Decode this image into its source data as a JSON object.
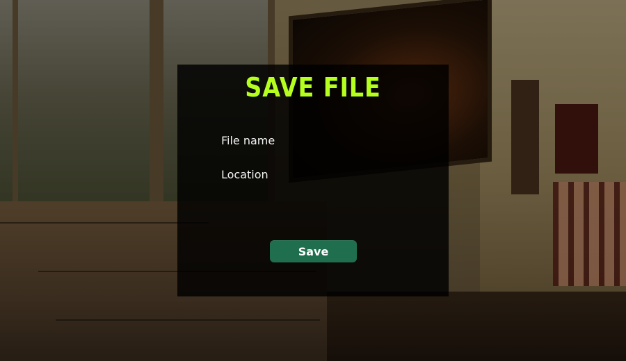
{
  "dialog": {
    "title": "SAVE FILE",
    "title_color": "#b5ff1e",
    "fields": [
      {
        "label": "File name",
        "value": "",
        "placeholder": ""
      },
      {
        "label": "Location",
        "value": "",
        "placeholder": ""
      }
    ],
    "save_label": "Save",
    "save_color": "#1f6e4e"
  }
}
